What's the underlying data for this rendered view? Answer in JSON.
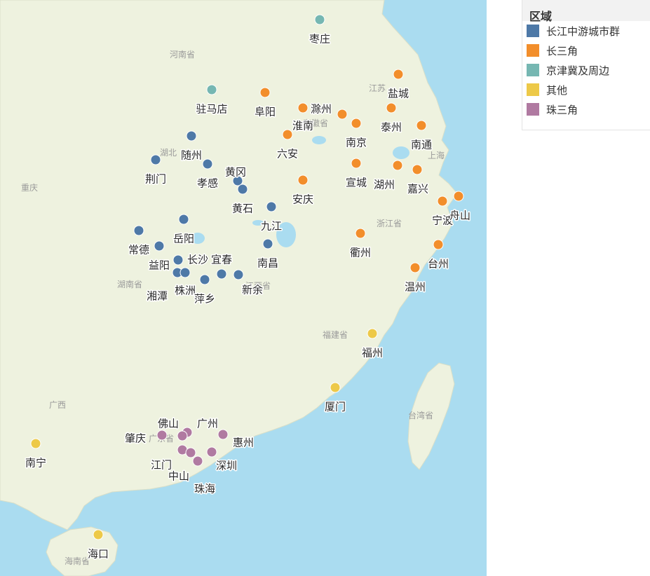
{
  "legend": {
    "title": "区域",
    "items": [
      {
        "label": "长江中游城市群",
        "color": "#4e79a7"
      },
      {
        "label": "长三角",
        "color": "#f28e2b"
      },
      {
        "label": "京津冀及周边",
        "color": "#76b7b2"
      },
      {
        "label": "其他",
        "color": "#edc948"
      },
      {
        "label": "珠三角",
        "color": "#b07aa1"
      }
    ]
  },
  "map": {
    "provinces": [
      "河南省",
      "湖北",
      "重庆",
      "湖南省",
      "江苏",
      "安徽省",
      "浙江省",
      "江西省",
      "福建省",
      "广西",
      "广东省",
      "台湾省",
      "海南省",
      "上海"
    ],
    "colors": {
      "water": "#aadcf0",
      "land": "#eef2df"
    },
    "cities": [
      {
        "name": "枣庄",
        "region": 2
      },
      {
        "name": "盐城",
        "region": 1
      },
      {
        "name": "驻马店",
        "region": 2
      },
      {
        "name": "阜阳",
        "region": 1
      },
      {
        "name": "滁州",
        "region": 1
      },
      {
        "name": "淮南",
        "region": 1
      },
      {
        "name": "泰州",
        "region": 1
      },
      {
        "name": "南通",
        "region": 1
      },
      {
        "name": "南京",
        "region": 1
      },
      {
        "name": "六安",
        "region": 1
      },
      {
        "name": "随州",
        "region": 0
      },
      {
        "name": "荆门",
        "region": 0
      },
      {
        "name": "孝感",
        "region": 0
      },
      {
        "name": "黄冈",
        "region": 0
      },
      {
        "name": "黄石",
        "region": 0
      },
      {
        "name": "宣城",
        "region": 1
      },
      {
        "name": "湖州",
        "region": 1
      },
      {
        "name": "嘉兴",
        "region": 1
      },
      {
        "name": "安庆",
        "region": 1
      },
      {
        "name": "宁波",
        "region": 1
      },
      {
        "name": "舟山",
        "region": 1
      },
      {
        "name": "九江",
        "region": 0
      },
      {
        "name": "岳阳",
        "region": 0
      },
      {
        "name": "常德",
        "region": 0
      },
      {
        "name": "衢州",
        "region": 1
      },
      {
        "name": "益阳",
        "region": 0
      },
      {
        "name": "长沙",
        "region": 0
      },
      {
        "name": "宜春",
        "region": 0
      },
      {
        "name": "南昌",
        "region": 0
      },
      {
        "name": "台州",
        "region": 1
      },
      {
        "name": "温州",
        "region": 1
      },
      {
        "name": "湘潭",
        "region": 0
      },
      {
        "name": "株洲",
        "region": 0
      },
      {
        "name": "萍乡",
        "region": 0
      },
      {
        "name": "新余",
        "region": 0
      },
      {
        "name": "福州",
        "region": 3
      },
      {
        "name": "厦门",
        "region": 3
      },
      {
        "name": "佛山",
        "region": 4
      },
      {
        "name": "广州",
        "region": 4
      },
      {
        "name": "肇庆",
        "region": 4
      },
      {
        "name": "惠州",
        "region": 4
      },
      {
        "name": "江门",
        "region": 4
      },
      {
        "name": "中山",
        "region": 4
      },
      {
        "name": "深圳",
        "region": 4
      },
      {
        "name": "珠海",
        "region": 4
      },
      {
        "name": "南宁",
        "region": 3
      },
      {
        "name": "海口",
        "region": 3
      }
    ]
  }
}
